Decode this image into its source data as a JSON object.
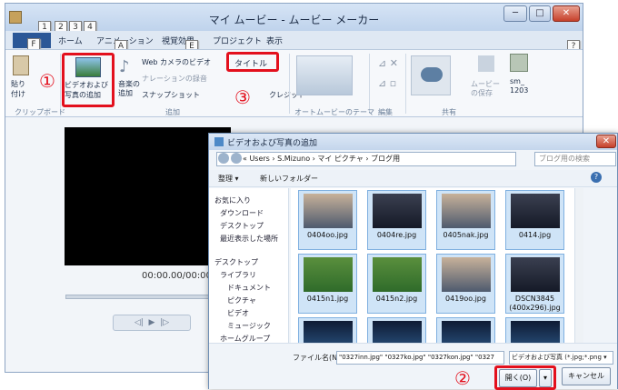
{
  "app": {
    "title": "マイ ムービー - ムービー メーカー",
    "file_tab": "F",
    "tabs": [
      "ホーム",
      "アニメーション",
      "視覚効果",
      "プロジェクト",
      "表示"
    ],
    "keytips": {
      "qat": [
        "1",
        "2",
        "3",
        "4"
      ],
      "file": "F",
      "home_add": "A",
      "visual": "E",
      "help": "?"
    },
    "window_buttons": [
      "─",
      "□",
      "✕"
    ]
  },
  "ribbon": {
    "paste": "貼り付け",
    "add_media": [
      "ビデオおよび",
      "写真の追加"
    ],
    "music": [
      "音楽の",
      "追加"
    ],
    "webcam": "Web カメラのビデオ",
    "narration": "ナレーションの録音",
    "snapshot": "スナップショット",
    "title": "タイトル",
    "credit": "クレジット",
    "movie_save": [
      "ムービー",
      "の保存"
    ],
    "account": [
      "sm_",
      "1203"
    ],
    "groups": [
      "クリップボード",
      "追加",
      "オートムービーのテーマ",
      "編集",
      "共有"
    ]
  },
  "annotations": {
    "one": "①",
    "two": "②",
    "three": "③"
  },
  "player": {
    "time": "00:00.00/00:00.00",
    "controls": [
      "◁|",
      "▶",
      "|▷"
    ]
  },
  "dialog": {
    "title": "ビデオおよび写真の追加",
    "breadcrumb": "« Users › S.Mizuno › マイ ピクチャ › ブログ用",
    "search_placeholder": "ブログ用の検索",
    "toolbar": [
      "整理 ▾",
      "新しいフォルダー"
    ],
    "nav": [
      "お気に入り",
      "ダウンロード",
      "デスクトップ",
      "最近表示した場所",
      "デスクトップ",
      "ライブラリ",
      "ドキュメント",
      "ピクチャ",
      "ビデオ",
      "ミュージック",
      "ホームグループ"
    ],
    "files": [
      {
        "name": "0404oo.jpg",
        "style": "face"
      },
      {
        "name": "0404re.jpg",
        "style": "crowd"
      },
      {
        "name": "0405nak.jpg",
        "style": "face"
      },
      {
        "name": "0414.jpg",
        "style": "crowd"
      },
      {
        "name": "0415n1.jpg",
        "style": "field"
      },
      {
        "name": "0415n2.jpg",
        "style": "field"
      },
      {
        "name": "0419oo.jpg",
        "style": "face"
      },
      {
        "name": "DSCN3845 (400x296).jpg",
        "style": "crowd"
      },
      {
        "name": "",
        "style": "night"
      },
      {
        "name": "",
        "style": "night"
      },
      {
        "name": "",
        "style": "night"
      },
      {
        "name": "",
        "style": "night"
      }
    ],
    "filename_label": "ファイル名(N):",
    "filename_value": "\"0327inn.jpg\" \"0327ko.jpg\" \"0327kon.jpg\" \"0327",
    "filter": "ビデオおよび写真 (*.jpg;*.png ▾",
    "open": "開く(O)",
    "cancel": "キャンセル"
  },
  "colors": {
    "accent_red": "#e3101d",
    "selection": "#cfe4f7",
    "file_tab": "#2b5797"
  }
}
